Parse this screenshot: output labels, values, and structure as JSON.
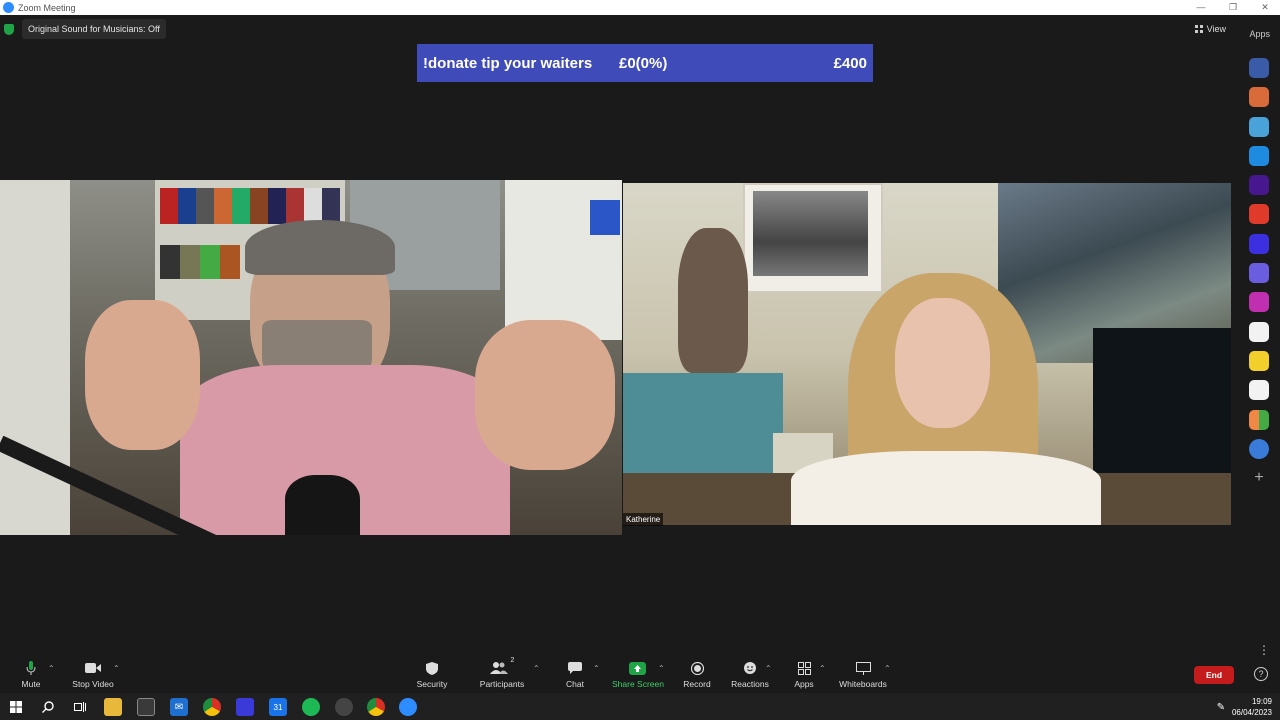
{
  "window": {
    "title": "Zoom Meeting"
  },
  "header": {
    "original_sound": "Original Sound for Musicians: Off",
    "view_label": "View",
    "apps_label": "Apps"
  },
  "banner": {
    "text": "!donate tip your waiters",
    "amount": "£0(0%)",
    "goal": "£400",
    "color": "#3f4bb8"
  },
  "participants": [
    {
      "name": ""
    },
    {
      "name": "Katherine"
    }
  ],
  "side_apps": [
    {
      "icon": "avatar-app-icon",
      "color": "#3a5ba8"
    },
    {
      "icon": "portrait-app-icon",
      "color": "#d96b3a"
    },
    {
      "icon": "mail-app-icon",
      "color": "#4aa3d8"
    },
    {
      "icon": "play-app-icon",
      "color": "#1f8be0"
    },
    {
      "icon": "kahoot-icon",
      "color": "#46178f"
    },
    {
      "icon": "red-app-icon",
      "color": "#e03a2a"
    },
    {
      "icon": "w-app-icon",
      "color": "#3b2fe0"
    },
    {
      "icon": "ai-app-icon",
      "color": "#6a5de0"
    },
    {
      "icon": "wave-app-icon",
      "color": "#c02fb0"
    },
    {
      "icon": "sesh-app-icon",
      "color": "#f2f2f2"
    },
    {
      "icon": "smiley-app-icon",
      "color": "#f2cf2a"
    },
    {
      "icon": "twine-app-icon",
      "color": "#f2f2f2"
    },
    {
      "icon": "grid-app-icon",
      "color": "#e8e8e8"
    },
    {
      "icon": "refresh-app-icon",
      "color": "#3a7ad8"
    },
    {
      "icon": "add-app-icon",
      "color": "#1a1a1a"
    }
  ],
  "toolbar": {
    "mute": "Mute",
    "stop_video": "Stop Video",
    "security": "Security",
    "participants": "Participants",
    "participants_count": "2",
    "chat": "Chat",
    "share_screen": "Share Screen",
    "record": "Record",
    "reactions": "Reactions",
    "apps": "Apps",
    "whiteboards": "Whiteboards",
    "end": "End",
    "share_color": "#1ea446",
    "end_color": "#c41c1c"
  },
  "taskbar": {
    "time": "19:09",
    "date": "06/04/2023",
    "calendar_day": "31"
  }
}
